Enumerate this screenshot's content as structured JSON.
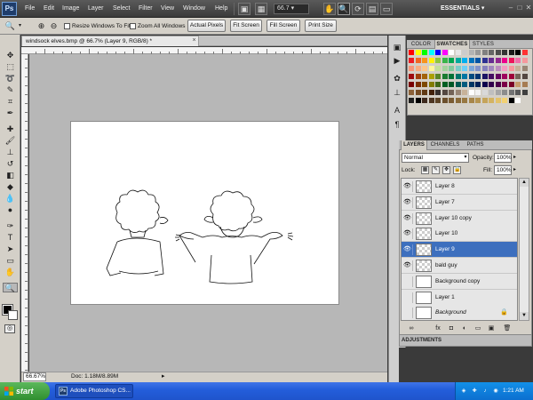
{
  "app": {
    "logo": "Ps",
    "menu": [
      "File",
      "Edit",
      "Image",
      "Layer",
      "Select",
      "Filter",
      "View",
      "Window",
      "Help"
    ],
    "zoom_display": "66.7",
    "workspace": "ESSENTIALS",
    "icons": [
      "bridge-icon",
      "view-extras-icon",
      "hand-icon",
      "zoom-icon",
      "rotate-view-icon",
      "arrange-documents-icon",
      "screen-mode-icon"
    ]
  },
  "options_bar": {
    "resize_windows_label": "Resize Windows To Fit",
    "zoom_all_label": "Zoom All Windows",
    "buttons": [
      "Actual Pixels",
      "Fit Screen",
      "Fill Screen",
      "Print Size"
    ]
  },
  "document": {
    "tab_title": "windsock elves.bmp @ 66.7% (Layer 9, RGB/8) *",
    "zoom": "66.67%",
    "doc_info": "Doc: 1.18M/8.89M"
  },
  "swatches_panel": {
    "tabs": [
      "COLOR",
      "SWATCHES",
      "STYLES"
    ],
    "active_tab": "SWATCHES"
  },
  "layers_panel": {
    "tabs": [
      "LAYERS",
      "CHANNELS",
      "PATHS"
    ],
    "active_tab": "LAYERS",
    "blend_mode": "Normal",
    "opacity_label": "Opacity:",
    "opacity": "100%",
    "lock_label": "Lock:",
    "fill_label": "Fill:",
    "fill": "100%",
    "layers": [
      {
        "name": "Layer 8",
        "visible": true,
        "selected": false
      },
      {
        "name": "Layer 7",
        "visible": true,
        "selected": false
      },
      {
        "name": "Layer 10 copy",
        "visible": true,
        "selected": false
      },
      {
        "name": "Layer 10",
        "visible": true,
        "selected": false
      },
      {
        "name": "Layer 9",
        "visible": true,
        "selected": true
      },
      {
        "name": "bald guy",
        "visible": true,
        "selected": false
      },
      {
        "name": "Background copy",
        "visible": false,
        "selected": false
      },
      {
        "name": "Layer 1",
        "visible": false,
        "selected": false
      },
      {
        "name": "Background",
        "visible": false,
        "selected": false
      }
    ]
  },
  "adjustments_panel": {
    "title": "ADJUSTMENTS"
  },
  "taskbar": {
    "start_label": "start",
    "task_item": "Adobe Photoshop CS...",
    "clock": "1:21 AM"
  },
  "colors": {
    "selected_layer": "#3d6fbe",
    "taskbar_blue": "#245edb",
    "start_green": "#3a9a3a"
  }
}
